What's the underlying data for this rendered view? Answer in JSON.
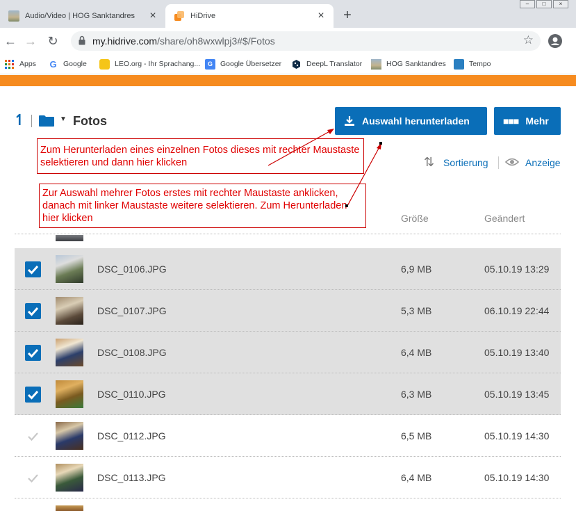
{
  "browser": {
    "tabs": [
      {
        "title": "Audio/Video | HOG Sanktandres",
        "active": false
      },
      {
        "title": "HiDrive",
        "active": true
      }
    ],
    "new_tab_label": "+",
    "url_host": "my.hidrive.com",
    "url_path": "/share/oh8wxwlpj3#$/Fotos",
    "bookmarks": [
      "Apps",
      "Google",
      "LEO.org - Ihr Sprachang...",
      "Google Übersetzer",
      "DeepL Translator",
      "HOG Sanktandres",
      "Tempo"
    ]
  },
  "hidrive": {
    "folder_name": "Fotos",
    "download_button": "Auswahl herunterladen",
    "more_button": "Mehr",
    "sort_link": "Sortierung",
    "view_link": "Anzeige",
    "columns": {
      "size": "Größe",
      "changed": "Geändert"
    },
    "files": [
      {
        "name": "DSC_0106.JPG",
        "size": "6,9 MB",
        "changed": "05.10.19 13:29",
        "selected": true
      },
      {
        "name": "DSC_0107.JPG",
        "size": "5,3 MB",
        "changed": "06.10.19 22:44",
        "selected": true
      },
      {
        "name": "DSC_0108.JPG",
        "size": "6,4 MB",
        "changed": "05.10.19 13:40",
        "selected": true
      },
      {
        "name": "DSC_0110.JPG",
        "size": "6,3 MB",
        "changed": "05.10.19 13:45",
        "selected": true
      },
      {
        "name": "DSC_0112.JPG",
        "size": "6,5 MB",
        "changed": "05.10.19 14:30",
        "selected": false
      },
      {
        "name": "DSC_0113.JPG",
        "size": "6,4 MB",
        "changed": "05.10.19 14:30",
        "selected": false
      }
    ]
  },
  "annotations": {
    "single_photo": "Zum Herunterladen eines einzelnen Fotos dieses mit rechter Maustaste selektieren und dann hier klicken",
    "multi_photo": "Zur Auswahl mehrer Fotos erstes mit rechter Maustaste anklicken, danach mit linker Maustaste weitere selektieren. Zum Herunterladen hier klicken"
  },
  "colors": {
    "brand_orange": "#f68b1f",
    "brand_blue": "#0a6eb8",
    "annotation_red": "#e00000",
    "selected_row": "#e0e0e0"
  }
}
